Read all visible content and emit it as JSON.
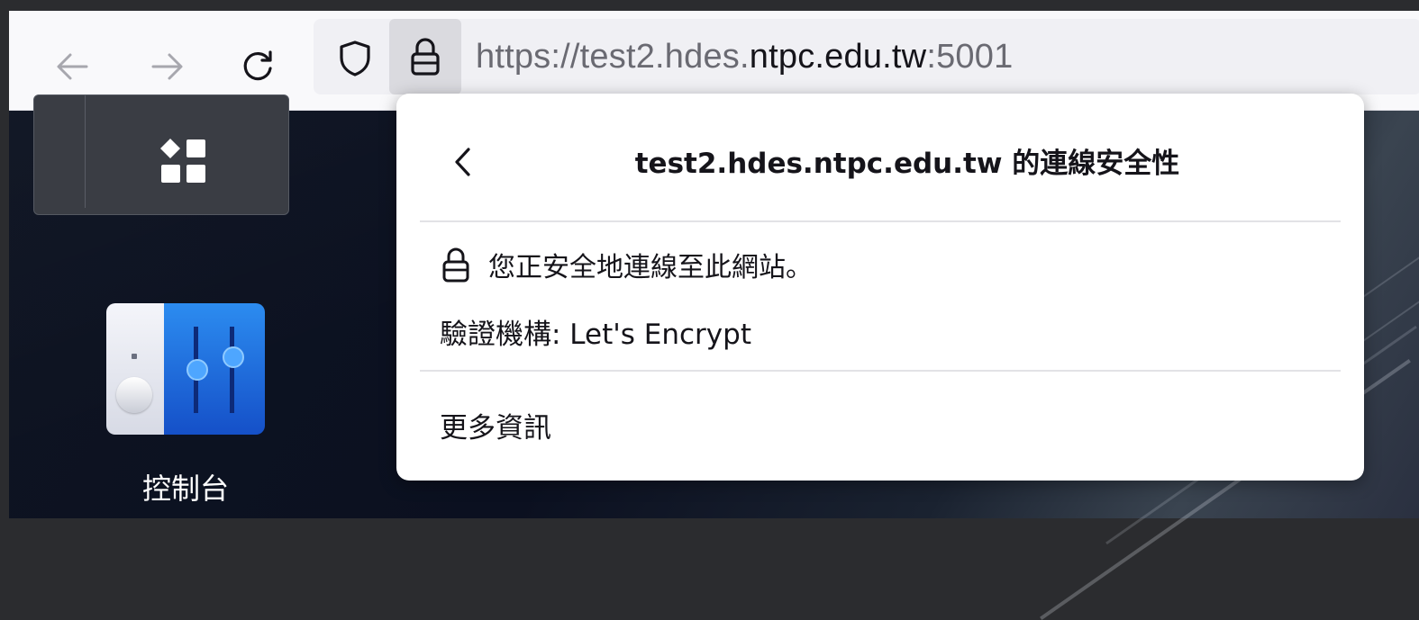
{
  "toolbar": {
    "back_icon": "arrow-left-icon",
    "forward_icon": "arrow-right-icon",
    "reload_icon": "reload-icon",
    "shield_icon": "shield-icon",
    "lock_icon": "lock-icon",
    "url_prefix": "https://test2.hdes.",
    "url_host": "ntpc.edu.tw",
    "url_suffix": ":5001"
  },
  "desktop": {
    "widget_icon": "app-grid-icon",
    "control_panel_icon": "control-panel-icon",
    "control_panel_label": "控制台"
  },
  "popup": {
    "back_icon": "chevron-left-icon",
    "title": "test2.hdes.ntpc.edu.tw 的連線安全性",
    "secure_icon": "lock-icon",
    "secure_text": "您正安全地連線至此網站。",
    "issuer_text": "驗證機構: Let's Encrypt",
    "more_info_label": "更多資訊"
  },
  "colors": {
    "toolbar_bg": "#f9f9fb",
    "urlbar_bg": "#f0f0f4",
    "text_primary": "#15141a",
    "text_muted": "#6a6a72",
    "accent_blue": "#1f6fe0"
  }
}
